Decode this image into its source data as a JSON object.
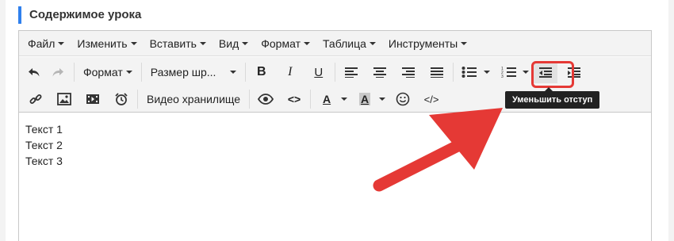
{
  "section": {
    "title": "Содержимое урока"
  },
  "menubar": {
    "items": [
      {
        "label": "Файл"
      },
      {
        "label": "Изменить"
      },
      {
        "label": "Вставить"
      },
      {
        "label": "Вид"
      },
      {
        "label": "Формат"
      },
      {
        "label": "Таблица"
      },
      {
        "label": "Инструменты"
      }
    ]
  },
  "toolbar": {
    "format_dropdown": "Формат",
    "font_size_dropdown": "Размер шр...",
    "bold_glyph": "B",
    "italic_glyph": "I",
    "underline_glyph": "U",
    "video_storage": "Видео хранилище",
    "text_color_glyph": "A",
    "bg_color_glyph": "A",
    "code_glyph": "</>",
    "source_glyph": "<>"
  },
  "tooltip": {
    "text": "Уменьшить отступ"
  },
  "content": {
    "paragraphs": [
      "Текст 1",
      "Текст 2",
      "Текст 3"
    ]
  },
  "colors": {
    "accent": "#2f80ed",
    "highlight": "#e53935",
    "arrow": "#e53935"
  }
}
